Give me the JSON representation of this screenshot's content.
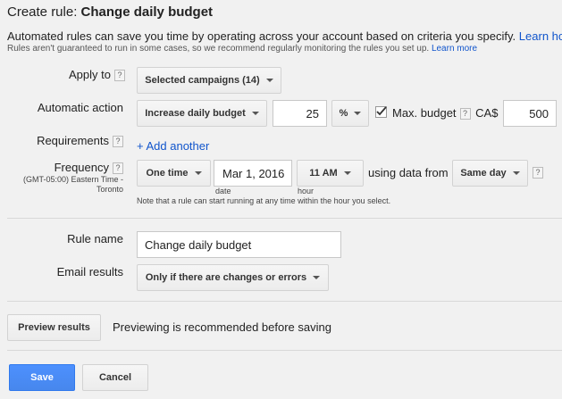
{
  "header": {
    "title_prefix": "Create rule:",
    "title_name": "Change daily budget",
    "description": "Automated rules can save you time by operating across your account based on criteria you specify.",
    "description_link": "Learn ho",
    "subdescription": "Rules aren't guaranteed to run in some cases, so we recommend regularly monitoring the rules you set up.",
    "subdescription_link": "Learn more"
  },
  "apply_to": {
    "label": "Apply to",
    "help": "?",
    "value": "Selected campaigns (14)"
  },
  "action": {
    "label": "Automatic action",
    "type": "Increase daily budget",
    "amount": "25",
    "unit": "%",
    "max_checked": true,
    "max_label": "Max. budget",
    "help": "?",
    "currency": "CA$",
    "max_value": "500"
  },
  "requirements": {
    "label": "Requirements",
    "help": "?",
    "add_another": "+ Add another"
  },
  "frequency": {
    "label": "Frequency",
    "help": "?",
    "timezone_line1": "(GMT-05:00) Eastern Time -",
    "timezone_line2": "Toronto",
    "frequency_value": "One time",
    "date_value": "Mar 1, 2016",
    "date_label": "date",
    "hour_value": "11 AM",
    "hour_label": "hour",
    "using_data_from": "using data from",
    "data_range": "Same day",
    "data_help": "?",
    "note": "Note that a rule can start running at any time within the hour you select."
  },
  "rule_name": {
    "label": "Rule name",
    "value": "Change daily budget"
  },
  "email": {
    "label": "Email results",
    "value": "Only if there are changes or errors"
  },
  "preview": {
    "button": "Preview results",
    "hint": "Previewing is recommended before saving"
  },
  "footer": {
    "save": "Save",
    "cancel": "Cancel"
  },
  "colors": {
    "primary_button": "#4d90fe",
    "link": "#1155cc",
    "background": "#f1f1f1"
  }
}
